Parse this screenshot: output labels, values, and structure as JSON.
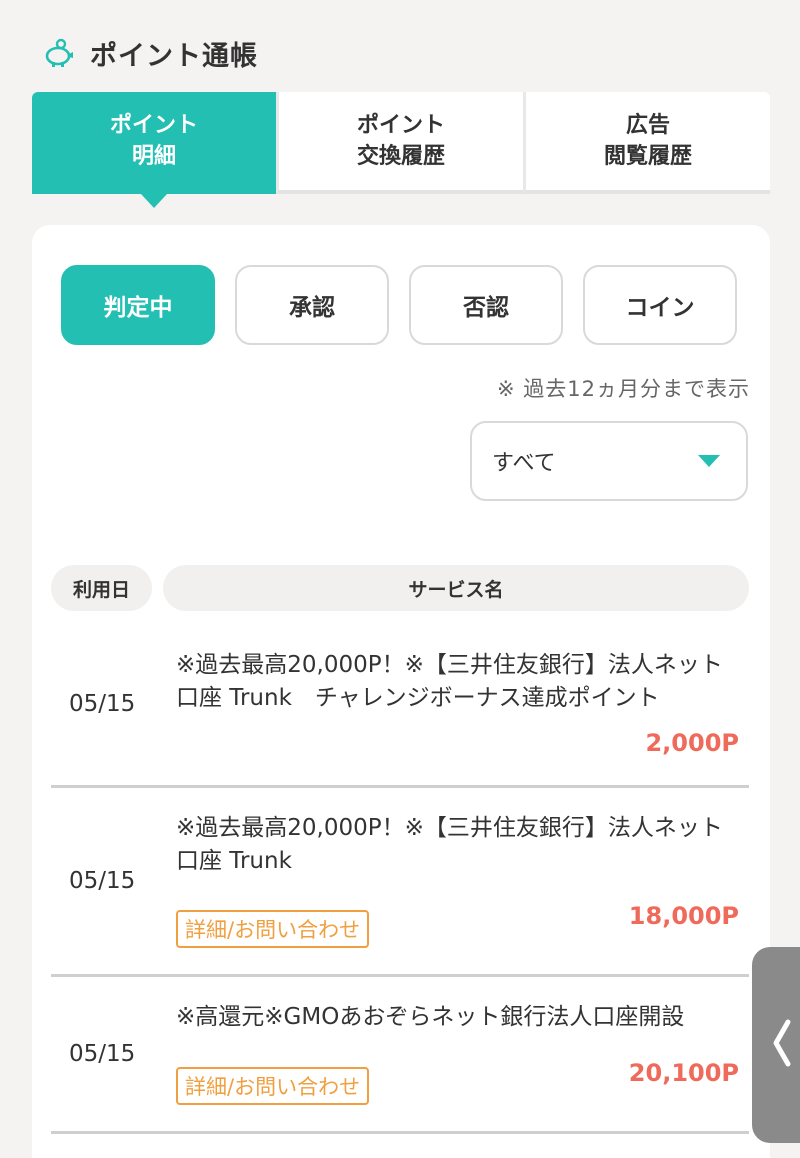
{
  "header": {
    "icon": "piggy-bank-icon",
    "title": "ポイント通帳"
  },
  "tabs": [
    {
      "label": "ポイント\n明細",
      "active": true
    },
    {
      "label": "ポイント\n交換履歴",
      "active": false
    },
    {
      "label": "広告\n閲覧履歴",
      "active": false
    }
  ],
  "filters": [
    {
      "label": "判定中",
      "active": true
    },
    {
      "label": "承認",
      "active": false
    },
    {
      "label": "否認",
      "active": false
    },
    {
      "label": "コイン",
      "active": false
    }
  ],
  "note": "※ 過去12ヵ月分まで表示",
  "select": {
    "value": "すべて"
  },
  "table": {
    "headers": {
      "date": "利用日",
      "service": "サービス名"
    },
    "rows": [
      {
        "date": "05/15",
        "service": "※過去最高20,000P！※【三井住友銀行】法人ネット口座 Trunk　チャレンジボーナス達成ポイント",
        "points": "2,000P",
        "detail": ""
      },
      {
        "date": "05/15",
        "service": "※過去最高20,000P！※【三井住友銀行】法人ネット口座 Trunk",
        "points": "18,000P",
        "detail": "詳細/お問い合わせ"
      },
      {
        "date": "05/15",
        "service": "※高還元※GMOあおぞらネット銀行法人口座開設",
        "points": "20,100P",
        "detail": "詳細/お問い合わせ"
      }
    ]
  },
  "colors": {
    "accent": "#24bfb3",
    "points": "#ef6a5a",
    "detail": "#f0a040"
  }
}
